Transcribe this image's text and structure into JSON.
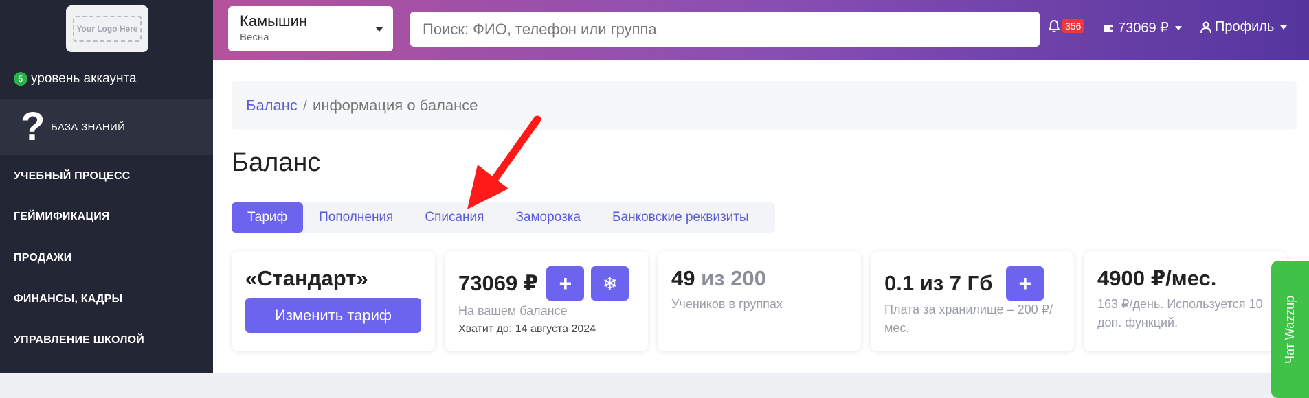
{
  "sidebar": {
    "logo_text": "Your Logo Here",
    "account_level_badge": "5",
    "account_level_label": "уровень аккаунта",
    "knowledge_base": {
      "icon": "?",
      "label": "БАЗА ЗНАНИЙ"
    },
    "nav": [
      {
        "label": "УЧЕБНЫЙ ПРОЦЕСС"
      },
      {
        "label": "ГЕЙМИФИКАЦИЯ"
      },
      {
        "label": "ПРОДАЖИ"
      },
      {
        "label": "ФИНАНСЫ, КАДРЫ"
      },
      {
        "label": "УПРАВЛЕНИЕ ШКОЛОЙ"
      }
    ]
  },
  "header": {
    "city": {
      "name": "Камышин",
      "season": "Весна"
    },
    "search": {
      "placeholder": "Поиск: ФИО, телефон или группа",
      "value": ""
    },
    "notifications": {
      "icon": "bell-icon",
      "count": "356"
    },
    "balance": {
      "icon": "wallet-icon",
      "value": "73069 ₽"
    },
    "profile": {
      "icon": "user-icon",
      "label": "Профиль"
    }
  },
  "breadcrumb": {
    "link": "Баланс",
    "separator": "/",
    "current": "информация о балансе"
  },
  "page_title": "Баланс",
  "tabs": [
    {
      "label": "Тариф",
      "active": true
    },
    {
      "label": "Пополнения",
      "active": false
    },
    {
      "label": "Списания",
      "active": false
    },
    {
      "label": "Заморозка",
      "active": false
    },
    {
      "label": "Банковские реквизиты",
      "active": false
    }
  ],
  "cards": {
    "tariff": {
      "title": "«Стандарт»",
      "button": "Изменить тариф"
    },
    "balance": {
      "title": "73069 ₽",
      "add_icon": "+",
      "freeze_icon": "❄",
      "subtitle": "На вашем балансе",
      "note": "Хватит до: 14 августа 2024"
    },
    "students": {
      "count": "49",
      "of": "из 200",
      "subtitle": "Учеников в группах"
    },
    "storage": {
      "title": "0.1 из 7 Гб",
      "add_icon": "+",
      "subtitle": "Плата за хранилище – 200 ₽/мес."
    },
    "price": {
      "title": "4900 ₽/мес.",
      "subtitle": "163 ₽/день. Используется 10 доп. функций."
    }
  },
  "wazzup": {
    "label": "Чат Wazzup"
  },
  "colors": {
    "accent": "#6c63ef",
    "sidebar_bg": "#232634",
    "header_gradient_start": "#b4529d",
    "header_gradient_end": "#54369e",
    "notification_badge": "#e8393e",
    "wazzup_green": "#3fc247",
    "annotation_arrow": "#ff1a1a"
  }
}
